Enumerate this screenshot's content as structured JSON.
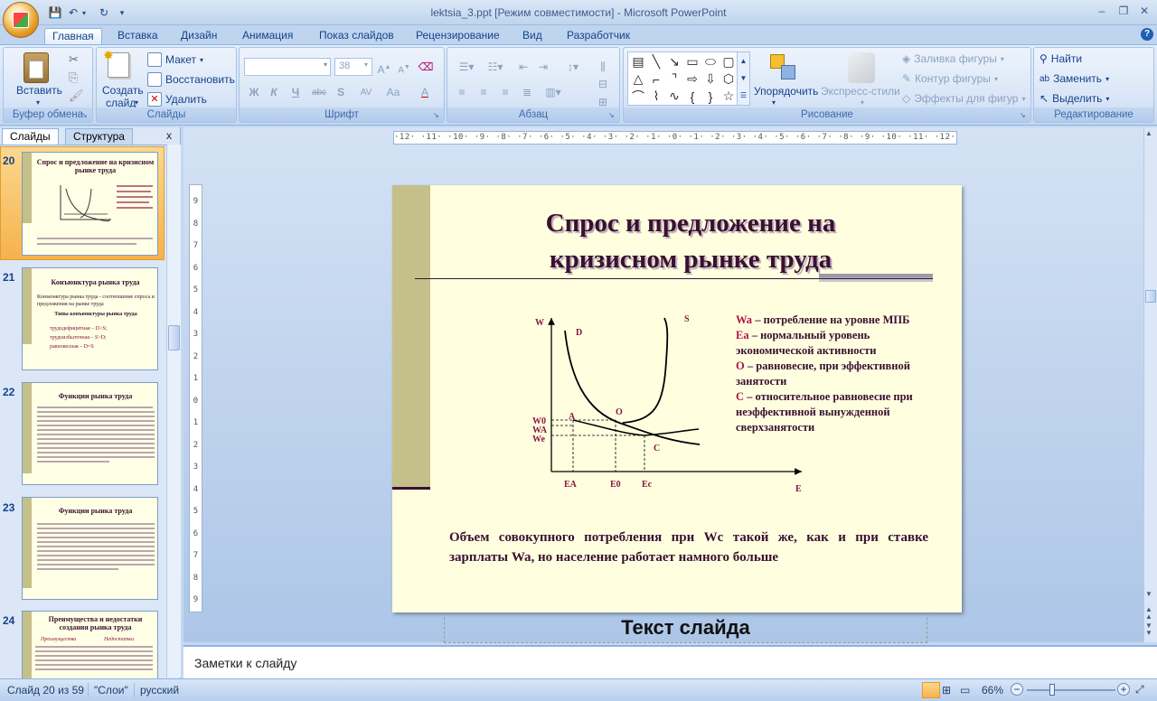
{
  "window": {
    "title": "lektsia_3.ppt [Режим совместимости] - Microsoft PowerPoint",
    "help": "?"
  },
  "tabs": [
    "Главная",
    "Вставка",
    "Дизайн",
    "Анимация",
    "Показ слайдов",
    "Рецензирование",
    "Вид",
    "Разработчик"
  ],
  "ribbon": {
    "clipboard": {
      "paste": "Вставить",
      "label": "Буфер обмена"
    },
    "slides": {
      "create": "Создать",
      "create2": "слайд",
      "layout": "Макет",
      "reset": "Восстановить",
      "delete": "Удалить",
      "label": "Слайды"
    },
    "font": {
      "size": "38",
      "label": "Шрифт",
      "bold": "Ж",
      "italic": "К",
      "underline": "Ч",
      "strike": "abc",
      "shadow": "S",
      "spacing": "AV",
      "case": "Aa",
      "color": "A"
    },
    "paragraph": {
      "label": "Абзац"
    },
    "drawing": {
      "arrange": "Упорядочить",
      "quickstyles": "Экспресс-стили",
      "fill": "Заливка фигуры",
      "outline": "Контур фигуры",
      "effects": "Эффекты для фигур",
      "label": "Рисование"
    },
    "editing": {
      "find": "Найти",
      "replace": "Заменить",
      "select": "Выделить",
      "label": "Редактирование"
    }
  },
  "panel": {
    "tab_slides": "Слайды",
    "tab_outline": "Структура",
    "close": "x"
  },
  "thumbnails": [
    {
      "num": "20",
      "title": "Спрос и предложение на кризисном рынке труда"
    },
    {
      "num": "21",
      "title": "Конъюнктура рынка труда"
    },
    {
      "num": "22",
      "title": "Функции рынка труда"
    },
    {
      "num": "23",
      "title": "Функции рынка труда"
    },
    {
      "num": "24",
      "title": "Преимущества и недостатки создания рынка труда"
    }
  ],
  "thumb_text": {
    "t21_a": "Конъюнктура рынка труда - соотношение спроса и предложения на рынке труда",
    "t21_b": "Типы конъюнктуры рынка труда",
    "t21_c": [
      "трудодефицитная – D>S;",
      "трудоизбыточная – S>D;",
      "равновесная – D=S"
    ],
    "t24_a": "Преимущества",
    "t24_b": "Недостатки"
  },
  "rulers": {
    "h": "·12·  ·11·  ·10·  ·9·  ·8·  ·7·  ·6·  ·5·  ·4·  ·3·  ·2·  ·1·  ·0·  ·1·  ·2·  ·3·  ·4·  ·5·  ·6·  ·7·  ·8·  ·9·  ·10·  ·11·  ·12·",
    "v": [
      "9",
      "8",
      "7",
      "6",
      "5",
      "4",
      "3",
      "2",
      "1",
      "0",
      "1",
      "2",
      "3",
      "4",
      "5",
      "6",
      "7",
      "8",
      "9"
    ]
  },
  "slide": {
    "title_line1": "Спрос и предложение на",
    "title_line2": "кризисном рынке труда",
    "legend": [
      {
        "key": "Wa",
        "text": " – потребление на уровне МПБ"
      },
      {
        "key": "Ea",
        "text": " – нормальный уровень экономической активности"
      },
      {
        "key": "O",
        "text": " – равновесие, при  эффективной занятости"
      },
      {
        "key": "C",
        "text": " – относительное равновесие при неэффективной вынужденной сверхзанятости"
      }
    ],
    "body": "Объем совокупного потребления при Wc такой же, как и при ставке зарплаты Wa, но население работает намного больше",
    "chart_labels": {
      "W": "W",
      "D": "D",
      "S": "S",
      "O": "O",
      "A": "A",
      "C": "C",
      "W0": "W0",
      "WA": "WA",
      "We": "We",
      "EA": "EA",
      "E0": "E0",
      "Ec": "Ec",
      "E": "E"
    }
  },
  "text_placeholder": "Текст слайда",
  "notes": "Заметки к слайду",
  "status": {
    "slide": "Слайд 20 из 59",
    "theme": "\"Слои\"",
    "lang": "русский",
    "zoom": "66%"
  }
}
